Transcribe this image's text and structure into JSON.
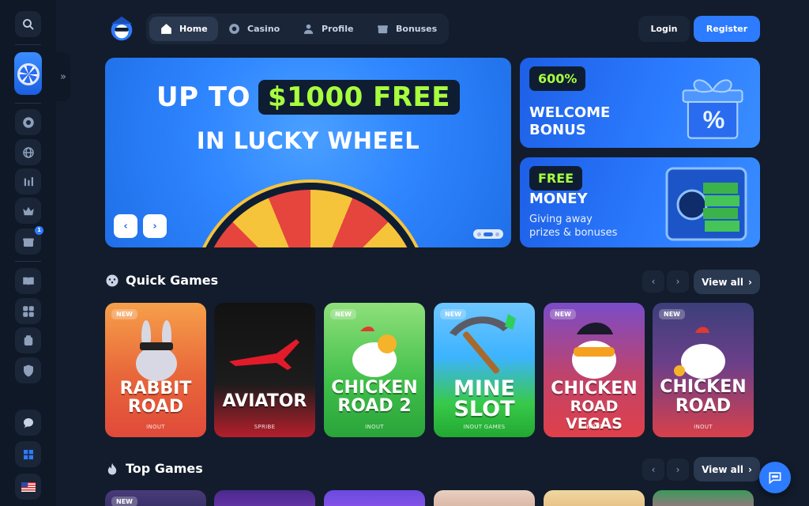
{
  "nav": {
    "items": [
      {
        "label": "Home",
        "icon": "home-icon",
        "active": true
      },
      {
        "label": "Casino",
        "icon": "casino-chip-icon",
        "active": false
      },
      {
        "label": "Profile",
        "icon": "profile-icon",
        "active": false
      },
      {
        "label": "Bonuses",
        "icon": "gift-icon",
        "active": false
      }
    ],
    "login_label": "Login",
    "register_label": "Register"
  },
  "sidebar": {
    "icons": [
      "search-icon",
      "lucky-wheel-promo",
      "casino-chip-icon",
      "sports-globe-icon",
      "live-stats-icon",
      "crown-icon",
      "gift-icon",
      "book-icon",
      "games-icon",
      "support-icon",
      "shield-icon",
      "chat-bubbles-icon",
      "windows-icon",
      "us-flag-icon"
    ],
    "gift_badge": "1"
  },
  "hero": {
    "line1_prefix": "UP TO",
    "line1_highlight": "$1000 FREE",
    "line2": "IN LUCKY WHEEL",
    "prev_label": "‹",
    "next_label": "›"
  },
  "promos": [
    {
      "tag": "600%",
      "title_line1": "WELCOME",
      "title_line2": "BONUS"
    },
    {
      "tag": "FREE",
      "title": "MONEY",
      "sub_line1": "Giving away",
      "sub_line2": "prizes & bonuses"
    }
  ],
  "quick_games": {
    "title": "Quick Games",
    "view_all": "View all",
    "games": [
      {
        "badge": "NEW",
        "name_line1": "RABBIT",
        "name_line2": "ROAD",
        "provider": "INOUT"
      },
      {
        "badge": "",
        "name_line1": "AVIATOR",
        "name_line2": "",
        "provider": "SPRIBE"
      },
      {
        "badge": "NEW",
        "name_line1": "CHICKEN",
        "name_line2": "ROAD 2",
        "provider": "INOUT"
      },
      {
        "badge": "NEW",
        "name_line1": "MINE",
        "name_line2": "SLOT",
        "provider": "INOUT GAMES"
      },
      {
        "badge": "NEW",
        "name_line1": "CHICKEN",
        "name_line2": "ROAD VEGAS",
        "provider": "INOUT"
      },
      {
        "badge": "NEW",
        "name_line1": "CHICKEN",
        "name_line2": "ROAD",
        "provider": "INOUT"
      }
    ]
  },
  "top_games": {
    "title": "Top Games",
    "view_all": "View all",
    "first_badge": "NEW"
  },
  "colors": {
    "background": "#121c2c",
    "accent": "#2d7bff",
    "highlight": "#a8ff3e"
  }
}
